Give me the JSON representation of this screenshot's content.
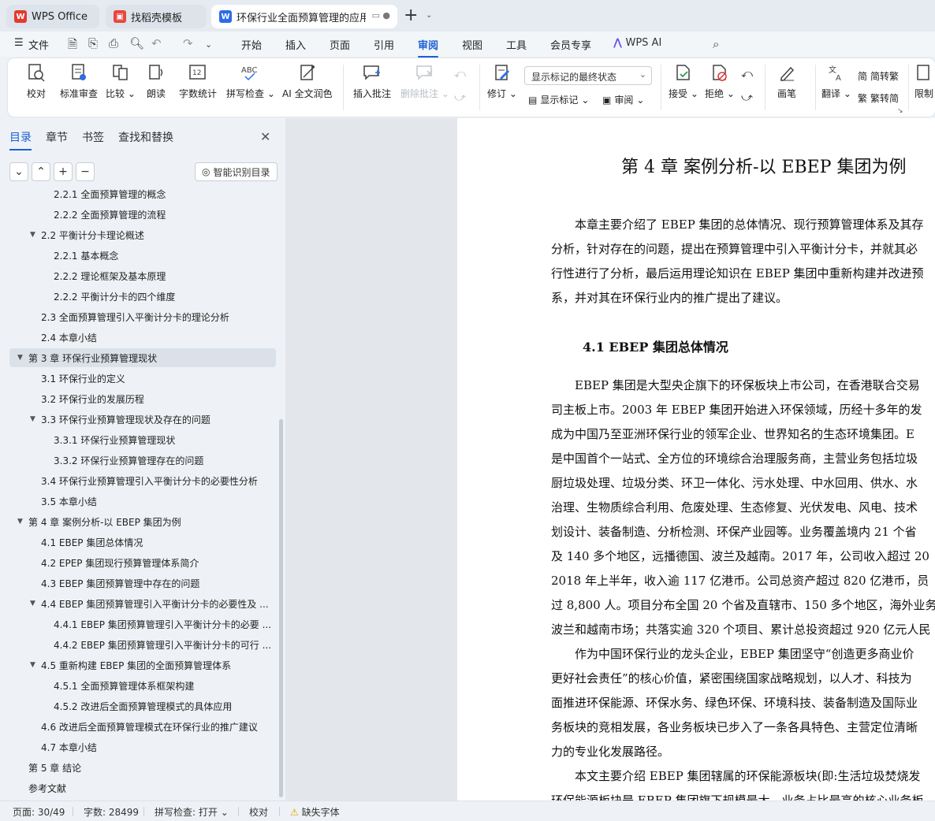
{
  "tabs": [
    {
      "label": "WPS Office"
    },
    {
      "label": "找稻壳模板"
    },
    {
      "label": "环保行业全面预算管理的应用研究"
    }
  ],
  "menu": {
    "file": "文件",
    "items": [
      "开始",
      "插入",
      "页面",
      "引用",
      "审阅",
      "视图",
      "工具",
      "会员专享"
    ],
    "active": "审阅",
    "wps_ai": "WPS AI"
  },
  "ribbon": {
    "proof": "校对",
    "std_review": "标准审查",
    "compare": "比较",
    "read_aloud": "朗读",
    "word_count": "字数统计",
    "spell_check": "拼写检查",
    "ai_polish": "AI 全文润色",
    "insert_comment": "插入批注",
    "delete_comment": "删除批注",
    "revise": "修订",
    "markup_dropdown": "显示标记的最终状态",
    "show_markup": "显示标记",
    "review": "审阅",
    "accept": "接受",
    "reject": "拒绝",
    "brush": "画笔",
    "translate": "翻译",
    "to_traditional": "简转繁",
    "to_simplified": "繁转简",
    "restrict": "限制"
  },
  "sidebar": {
    "tabs": [
      "目录",
      "章节",
      "书签",
      "查找和替换"
    ],
    "smart_toc": "智能识别目录",
    "toc": [
      {
        "label": "2.2.1  全面预算管理的概念",
        "level": 3,
        "toggle": ""
      },
      {
        "label": "2.2.2  全面预算管理的流程",
        "level": 3,
        "toggle": ""
      },
      {
        "label": "2.2  平衡计分卡理论概述",
        "level": 2,
        "toggle": "▼"
      },
      {
        "label": "2.2.1  基本概念",
        "level": 3,
        "toggle": ""
      },
      {
        "label": "2.2.2  理论框架及基本原理",
        "level": 3,
        "toggle": ""
      },
      {
        "label": "2.2.2  平衡计分卡的四个维度",
        "level": 3,
        "toggle": ""
      },
      {
        "label": "2.3  全面预算管理引入平衡计分卡的理论分析",
        "level": 2,
        "toggle": ""
      },
      {
        "label": "2.4  本章小结",
        "level": 2,
        "toggle": ""
      },
      {
        "label": "第 3 章  环保行业预算管理现状",
        "level": 1,
        "toggle": "▼",
        "selected": true
      },
      {
        "label": "3.1  环保行业的定义",
        "level": 2,
        "toggle": ""
      },
      {
        "label": "3.2  环保行业的发展历程",
        "level": 2,
        "toggle": ""
      },
      {
        "label": "3.3  环保行业预算管理现状及存在的问题",
        "level": 2,
        "toggle": "▼"
      },
      {
        "label": "3.3.1  环保行业预算管理现状",
        "level": 3,
        "toggle": ""
      },
      {
        "label": "3.3.2  环保行业预算管理存在的问题",
        "level": 3,
        "toggle": ""
      },
      {
        "label": "3.4  环保行业预算管理引入平衡计分卡的必要性分析",
        "level": 2,
        "toggle": ""
      },
      {
        "label": "3.5  本章小结",
        "level": 2,
        "toggle": ""
      },
      {
        "label": "第 4 章  案例分析-以 EBEP 集团为例",
        "level": 1,
        "toggle": "▼"
      },
      {
        "label": "4.1 EBEP 集团总体情况",
        "level": 2,
        "toggle": ""
      },
      {
        "label": "4.2 EPEP 集团现行预算管理体系简介",
        "level": 2,
        "toggle": ""
      },
      {
        "label": "4.3 EBEP 集团预算管理中存在的问题",
        "level": 2,
        "toggle": ""
      },
      {
        "label": "4.4 EBEP 集团预算管理引入平衡计分卡的必要性及 ...",
        "level": 2,
        "toggle": "▼"
      },
      {
        "label": "4.4.1 EBEP 集团预算管理引入平衡计分卡的必要 ...",
        "level": 3,
        "toggle": ""
      },
      {
        "label": "4.4.2 EBEP 集团预算管理引入平衡计分卡的可行 ...",
        "level": 3,
        "toggle": ""
      },
      {
        "label": "4.5 重新构建 EBEP 集团的全面预算管理体系",
        "level": 2,
        "toggle": "▼"
      },
      {
        "label": "4.5.1  全面预算管理体系框架构建",
        "level": 3,
        "toggle": ""
      },
      {
        "label": "4.5.2  改进后全面预算管理模式的具体应用",
        "level": 3,
        "toggle": ""
      },
      {
        "label": "4.6  改进后全面预算管理模式在环保行业的推广建议",
        "level": 2,
        "toggle": ""
      },
      {
        "label": "4.7  本章小结",
        "level": 2,
        "toggle": ""
      },
      {
        "label": "第 5 章  结论",
        "level": 1,
        "toggle": ""
      },
      {
        "label": "参考文献",
        "level": 1,
        "toggle": ""
      }
    ]
  },
  "document": {
    "chapter_title": "第 4 章  案例分析-以 EBEP 集团为例",
    "section_title": "4.1 EBEP 集团总体情况",
    "lines": [
      "　　本章主要介绍了 EBEP 集团的总体情况、现行预算管理体系及其存",
      "分析，针对存在的问题，提出在预算管理中引入平衡计分卡，并就其必",
      "行性进行了分析，最后运用理论知识在 EBEP 集团中重新构建并改进预",
      "系，并对其在环保行业内的推广提出了建议。",
      "　　EBEP 集团是大型央企旗下的环保板块上市公司，在香港联合交易",
      "司主板上市。2003 年 EBEP 集团开始进入环保领域，历经十多年的发",
      "成为中国乃至亚洲环保行业的领军企业、世界知名的生态环境集团。E",
      "是中国首个一站式、全方位的环境综合治理服务商，主营业务包括垃圾",
      "厨垃圾处理、垃圾分类、环卫一体化、污水处理、中水回用、供水、水",
      "治理、生物质综合利用、危废处理、生态修复、光伏发电、风电、技术",
      "划设计、装备制造、分析检测、环保产业园等。业务覆盖境内 21 个省",
      "及 140 多个地区，远播德国、波兰及越南。2017 年，公司收入超过 20",
      "2018 年上半年，收入逾 117 亿港币。公司总资产超过 820 亿港币，员",
      "过 8,800 人。项目分布全国 20 个省及直辖市、150 多个地区，海外业务进",
      "波兰和越南市场；共落实逾 320 个项目、累计总投资超过 920 亿元人民",
      "　　作为中国环保行业的龙头企业，EBEP 集团坚守“创造更多商业价",
      "更好社会责任”的核心价值，紧密围绕国家战略规划，以人才、科技为",
      "面推进环保能源、环保水务、绿色环保、环境科技、装备制造及国际业",
      "务板块的竞相发展，各业务板块已步入了一条各具特色、主营定位清晰",
      "力的专业化发展路径。",
      "　　本文主要介绍 EBEP 集团辖属的环保能源板块(即:生活垃圾焚烧发",
      "环保能源板块是 EBEP 集团旗下规模最大、业务占比最高的核心业务板"
    ]
  },
  "status": {
    "page": "页面: 30/49",
    "words": "字数: 28499",
    "spell": "拼写检查: 打开",
    "proof": "校对",
    "missing_font": "缺失字体"
  }
}
